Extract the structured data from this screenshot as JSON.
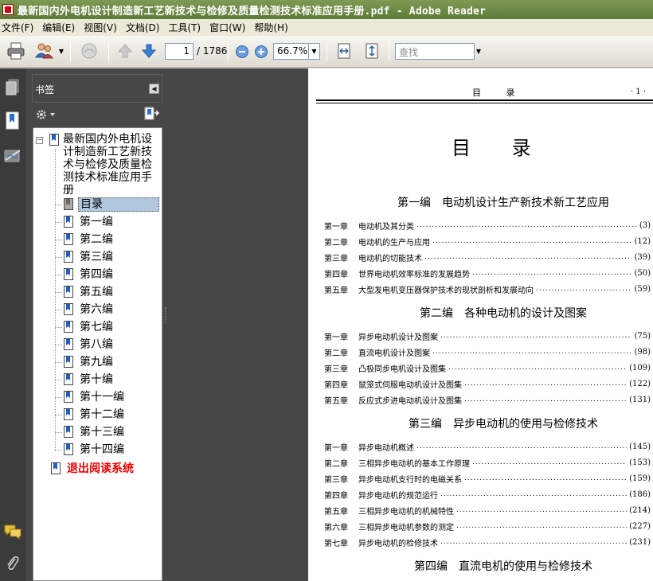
{
  "window": {
    "title": "最新国内外电机设计制造新工艺新技术与检修及质量检测技术标准应用手册.pdf - Adobe Reader"
  },
  "menu": [
    "文件(F)",
    "编辑(E)",
    "视图(V)",
    "文档(D)",
    "工具(T)",
    "窗口(W)",
    "帮助(H)"
  ],
  "toolbar": {
    "page_current": "1",
    "page_total": "/ 1786",
    "zoom": "66.7%",
    "search_placeholder": "查找"
  },
  "bookmarks": {
    "panel_title": "书签",
    "root_label": "最新国内外电机设计制造新工艺新技术与检修及质量检测技术标准应用手册",
    "items": [
      "目录",
      "第一编",
      "第二编",
      "第三编",
      "第四编",
      "第五编",
      "第六编",
      "第七编",
      "第八编",
      "第九编",
      "第十编",
      "第十一编",
      "第十二编",
      "第十三编",
      "第十四编"
    ],
    "selected": "目录",
    "exit_label": "退出阅读系统"
  },
  "page": {
    "running_title": "目 录",
    "page_number": "· 1 ·",
    "heading": "目 录",
    "parts": [
      {
        "title": "第一编　电动机设计生产新技术新工艺应用",
        "chapters": [
          {
            "ch": "第一章",
            "title": "电动机及其分类",
            "page": "(3)"
          },
          {
            "ch": "第二章",
            "title": "电动机的生产与应用",
            "page": "(12)"
          },
          {
            "ch": "第三章",
            "title": "电动机的切能技术",
            "page": "(39)"
          },
          {
            "ch": "第四章",
            "title": "世界电动机效率标准的发展趋势",
            "page": "(50)"
          },
          {
            "ch": "第五章",
            "title": "大型发电机变压器保护技术的现状剖析和发展动向",
            "page": "(59)"
          }
        ]
      },
      {
        "title": "第二编　各种电动机的设计及图案",
        "chapters": [
          {
            "ch": "第一章",
            "title": "异步电动机设计及图案",
            "page": "(75)"
          },
          {
            "ch": "第二章",
            "title": "直流电机设计及图案",
            "page": "(98)"
          },
          {
            "ch": "第三章",
            "title": "凸极同步电机设计及图集",
            "page": "(109)"
          },
          {
            "ch": "第四章",
            "title": "鼠笼式伺服电动机设计及图集",
            "page": "(122)"
          },
          {
            "ch": "第五章",
            "title": "反应式步进电动机设计及图集",
            "page": "(131)"
          }
        ]
      },
      {
        "title": "第三编　异步电动机的使用与检修技术",
        "chapters": [
          {
            "ch": "第一章",
            "title": "异步电动机概述",
            "page": "(145)"
          },
          {
            "ch": "第二章",
            "title": "三相异步电动机的基本工作原理",
            "page": "(153)"
          },
          {
            "ch": "第三章",
            "title": "异步电动机支行时的电磁关系",
            "page": "(159)"
          },
          {
            "ch": "第四章",
            "title": "异步电动机的规范运行",
            "page": "(186)"
          },
          {
            "ch": "第五章",
            "title": "三相异步电动机的机械特性",
            "page": "(214)"
          },
          {
            "ch": "第六章",
            "title": "三相异步电动机参数的测定",
            "page": "(227)"
          },
          {
            "ch": "第七章",
            "title": "异步电动机的检修技术",
            "page": "(231)"
          }
        ]
      },
      {
        "title": "第四编　直流电机的使用与检修技术",
        "chapters": []
      }
    ]
  }
}
